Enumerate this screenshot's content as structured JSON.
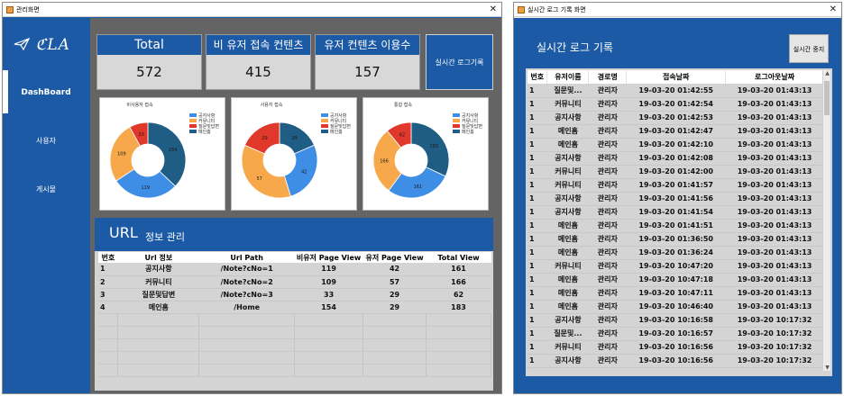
{
  "dashboard_window": {
    "title": "관리화면",
    "close_glyph": "✕",
    "logo": "ℭLA",
    "nav": [
      "DashBoard",
      "사용자",
      "게시물"
    ],
    "stats": [
      {
        "label": "Total",
        "value": "572"
      },
      {
        "label": "비 유저 접속 컨텐츠",
        "value": "415"
      },
      {
        "label": "유저 컨텐츠 이용수",
        "value": "157"
      }
    ],
    "realtime_button": "실시간 로그기록",
    "legend_labels": [
      "공지사항",
      "커뮤니티",
      "질문및답변",
      "메인홈"
    ],
    "legend_colors": [
      "#3f8ee6",
      "#f7a84a",
      "#e0382b",
      "#1f5d85"
    ],
    "charts": [
      {
        "title": "비사용자 접속",
        "values": [
          119,
          109,
          33,
          154
        ]
      },
      {
        "title": "사용자 접속",
        "values": [
          42,
          57,
          29,
          29
        ]
      },
      {
        "title": "통합 접속",
        "values": [
          161,
          166,
          62,
          183
        ]
      }
    ],
    "url_panel": {
      "title_main": "URL",
      "title_sub": "정보 관리",
      "columns": [
        "번호",
        "Url 정보",
        "Url Path",
        "비유저 Page View",
        "유저 Page View",
        "Total View"
      ],
      "rows": [
        [
          "1",
          "공지사항",
          "/Note?cNo=1",
          "119",
          "42",
          "161"
        ],
        [
          "2",
          "커뮤니티",
          "/Note?cNo=2",
          "109",
          "57",
          "166"
        ],
        [
          "3",
          "질문및답변",
          "/Note?cNo=3",
          "33",
          "29",
          "62"
        ],
        [
          "4",
          "메인홈",
          "/Home",
          "154",
          "29",
          "183"
        ]
      ]
    }
  },
  "log_window": {
    "title": "실시간 로그 기록 화면",
    "close_glyph": "✕",
    "header_title": "실시간 로그 기록",
    "stop_button": "실시간 중지",
    "columns": [
      "번호",
      "유저이름",
      "경로명",
      "접속날짜",
      "로그아웃날짜"
    ],
    "rows": [
      [
        "1",
        "질문및...",
        "관리자",
        "19-03-20 01:42:55",
        "19-03-20 01:43:13"
      ],
      [
        "1",
        "커뮤니티",
        "관리자",
        "19-03-20 01:42:54",
        "19-03-20 01:43:13"
      ],
      [
        "1",
        "공지사항",
        "관리자",
        "19-03-20 01:42:53",
        "19-03-20 01:43:13"
      ],
      [
        "1",
        "메인홈",
        "관리자",
        "19-03-20 01:42:47",
        "19-03-20 01:43:13"
      ],
      [
        "1",
        "메인홈",
        "관리자",
        "19-03-20 01:42:10",
        "19-03-20 01:43:13"
      ],
      [
        "1",
        "공지사항",
        "관리자",
        "19-03-20 01:42:08",
        "19-03-20 01:43:13"
      ],
      [
        "1",
        "커뮤니티",
        "관리자",
        "19-03-20 01:42:00",
        "19-03-20 01:43:13"
      ],
      [
        "1",
        "커뮤니티",
        "관리자",
        "19-03-20 01:41:57",
        "19-03-20 01:43:13"
      ],
      [
        "1",
        "공지사항",
        "관리자",
        "19-03-20 01:41:56",
        "19-03-20 01:43:13"
      ],
      [
        "1",
        "공지사항",
        "관리자",
        "19-03-20 01:41:54",
        "19-03-20 01:43:13"
      ],
      [
        "1",
        "메인홈",
        "관리자",
        "19-03-20 01:41:51",
        "19-03-20 01:43:13"
      ],
      [
        "1",
        "메인홈",
        "관리자",
        "19-03-20 01:36:50",
        "19-03-20 01:43:13"
      ],
      [
        "1",
        "메인홈",
        "관리자",
        "19-03-20 01:36:24",
        "19-03-20 01:43:13"
      ],
      [
        "1",
        "커뮤니티",
        "관리자",
        "19-03-20 10:47:20",
        "19-03-20 01:43:13"
      ],
      [
        "1",
        "메인홈",
        "관리자",
        "19-03-20 10:47:18",
        "19-03-20 01:43:13"
      ],
      [
        "1",
        "메인홈",
        "관리자",
        "19-03-20 10:47:11",
        "19-03-20 01:43:13"
      ],
      [
        "1",
        "메인홈",
        "관리자",
        "19-03-20 10:46:40",
        "19-03-20 01:43:13"
      ],
      [
        "1",
        "공지사항",
        "관리자",
        "19-03-20 10:16:58",
        "19-03-20 10:17:32"
      ],
      [
        "1",
        "질문및...",
        "관리자",
        "19-03-20 10:16:57",
        "19-03-20 10:17:32"
      ],
      [
        "1",
        "커뮤니티",
        "관리자",
        "19-03-20 10:16:56",
        "19-03-20 10:17:32"
      ],
      [
        "1",
        "공지사항",
        "관리자",
        "19-03-20 10:16:56",
        "19-03-20 10:17:32"
      ]
    ]
  },
  "chart_data": [
    {
      "type": "pie",
      "title": "비사용자 접속",
      "categories": [
        "공지사항",
        "커뮤니티",
        "질문및답변",
        "메인홈"
      ],
      "values": [
        119,
        109,
        33,
        154
      ]
    },
    {
      "type": "pie",
      "title": "사용자 접속",
      "categories": [
        "공지사항",
        "커뮤니티",
        "질문및답변",
        "메인홈"
      ],
      "values": [
        42,
        57,
        29,
        29
      ]
    },
    {
      "type": "pie",
      "title": "통합 접속",
      "categories": [
        "공지사항",
        "커뮤니티",
        "질문및답변",
        "메인홈"
      ],
      "values": [
        161,
        166,
        62,
        183
      ]
    }
  ]
}
